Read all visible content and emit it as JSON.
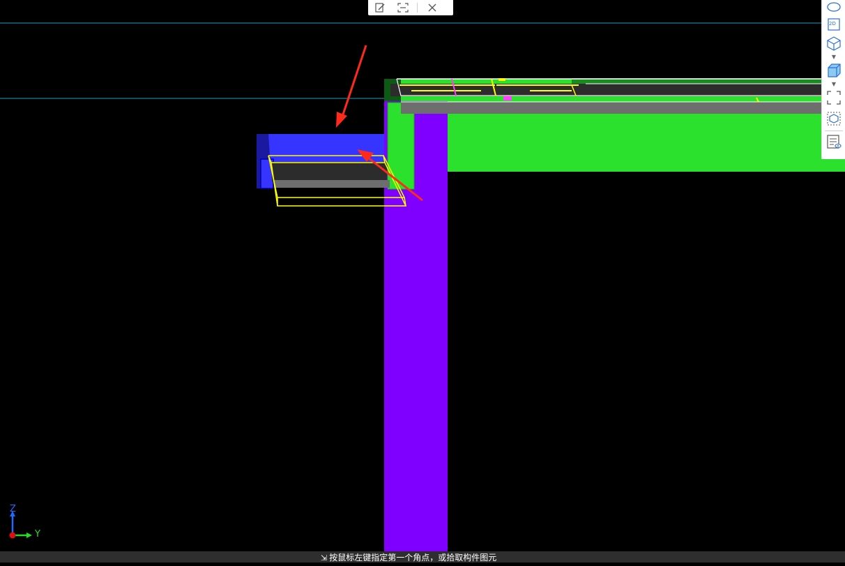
{
  "toolbar_top": {
    "edit_icon": "edit-icon",
    "select_icon": "select-region-icon",
    "close_icon": "close-icon"
  },
  "view_toolbar": {
    "items": [
      "orbit-icon",
      "view-2d-icon",
      "view-3d-icon",
      "shaded-box-icon",
      "fit-view-icon",
      "component-view-icon",
      "properties-view-icon"
    ],
    "label_2d": "2D"
  },
  "axis_indicator": {
    "z_label": "Z",
    "y_label": "Y"
  },
  "status_bar": {
    "message": "按鼠标左键指定第一个角点，或拾取构件图元"
  },
  "colors": {
    "background": "#000000",
    "column": "#8000ff",
    "slab": "#2ce02e",
    "beam_blue": "#3535ff",
    "outline_yellow": "#ffff00",
    "axis_line": "#1e9cc8",
    "annotation_arrow": "#ff2a1a"
  }
}
